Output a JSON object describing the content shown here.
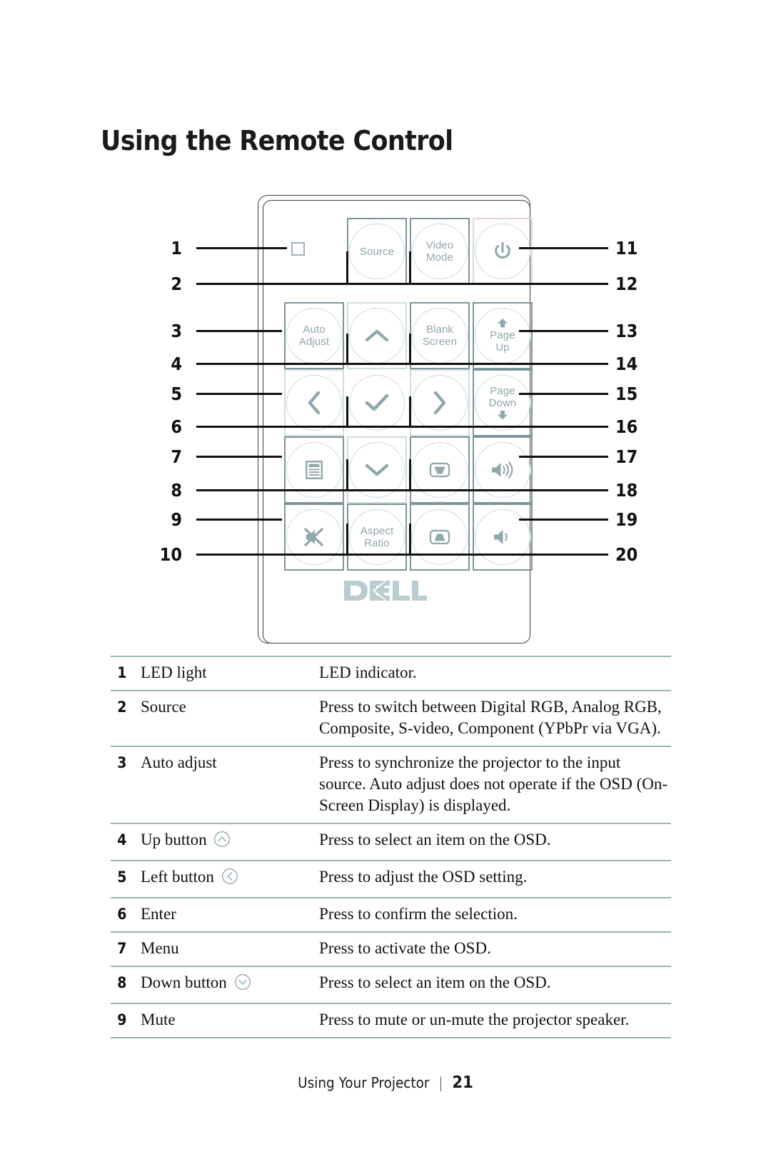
{
  "page": {
    "title": "Using the Remote Control",
    "footer_text": "Using Your Projector",
    "footer_separator": "|",
    "page_number": "21"
  },
  "colors": {
    "frame_teal": "#7d9499",
    "frame_pale": "#cfdcdc",
    "frame_pink": "#e6d5d6",
    "circle_outline": "#c7dbe2",
    "label_text": "#8fa5ab",
    "icon_fill": "#8fa8ad",
    "rule": "#9bb2b5",
    "dell_logo": "#b9cdd0",
    "callout": "#111111"
  },
  "remote": {
    "brand_logo": "DELL",
    "led_indicator_name": "led-light-square",
    "buttons": [
      {
        "id": "source",
        "label": "Source",
        "icon": null,
        "frame": "teal"
      },
      {
        "id": "video-mode",
        "label": "Video\nMode",
        "icon": null,
        "frame": "teal"
      },
      {
        "id": "power",
        "label": "",
        "icon": "power-icon",
        "frame": "pink"
      },
      {
        "id": "auto-adjust",
        "label": "Auto\nAdjust",
        "icon": null,
        "frame": "teal"
      },
      {
        "id": "up",
        "label": "",
        "icon": "chevron-up-icon",
        "frame": "pale"
      },
      {
        "id": "blank-screen",
        "label": "Blank\nScreen",
        "icon": null,
        "frame": "teal"
      },
      {
        "id": "page-up",
        "label": "Page\nUp",
        "icon": "arrow-up-solid-icon",
        "frame": "teal"
      },
      {
        "id": "left",
        "label": "",
        "icon": "chevron-left-icon",
        "frame": "pale"
      },
      {
        "id": "enter",
        "label": "",
        "icon": "check-icon",
        "frame": "none"
      },
      {
        "id": "right",
        "label": "",
        "icon": "chevron-right-icon",
        "frame": "pale"
      },
      {
        "id": "page-down",
        "label": "Page\nDown",
        "icon": "arrow-down-solid-icon",
        "frame": "teal"
      },
      {
        "id": "menu",
        "label": "",
        "icon": "menu-list-icon",
        "frame": "teal"
      },
      {
        "id": "down",
        "label": "",
        "icon": "chevron-down-icon",
        "frame": "pale"
      },
      {
        "id": "keystone-down",
        "label": "",
        "icon": "keystone-down-icon",
        "frame": "teal"
      },
      {
        "id": "volume-up",
        "label": "",
        "icon": "volume-up-icon",
        "frame": "teal"
      },
      {
        "id": "mute",
        "label": "",
        "icon": "mute-icon",
        "frame": "teal"
      },
      {
        "id": "aspect-ratio",
        "label": "Aspect\nRatio",
        "icon": null,
        "frame": "teal"
      },
      {
        "id": "keystone-up",
        "label": "",
        "icon": "keystone-up-icon",
        "frame": "teal"
      },
      {
        "id": "volume-down",
        "label": "",
        "icon": "volume-down-icon",
        "frame": "teal"
      }
    ],
    "button_labels": {
      "source": "Source",
      "video_mode_line1": "Video",
      "video_mode_line2": "Mode",
      "auto_adjust_line1": "Auto",
      "auto_adjust_line2": "Adjust",
      "blank_screen_line1": "Blank",
      "blank_screen_line2": "Screen",
      "page_up_line1": "Page",
      "page_up_line2": "Up",
      "page_down_line1": "Page",
      "page_down_line2": "Down",
      "aspect_ratio_line1": "Aspect",
      "aspect_ratio_line2": "Ratio"
    }
  },
  "callouts": {
    "left": [
      "1",
      "2",
      "3",
      "4",
      "5",
      "6",
      "7",
      "8",
      "9",
      "10"
    ],
    "right": [
      "11",
      "12",
      "13",
      "14",
      "15",
      "16",
      "17",
      "18",
      "19",
      "20"
    ]
  },
  "table": {
    "rows": [
      {
        "num": "1",
        "name": "LED light",
        "name_icon": null,
        "desc": "LED indicator."
      },
      {
        "num": "2",
        "name": "Source",
        "name_icon": null,
        "desc": "Press to switch between Digital RGB, Analog RGB, Composite, S-video, Component (YPbPr via VGA)."
      },
      {
        "num": "3",
        "name": "Auto adjust",
        "name_icon": null,
        "desc": "Press to synchronize the projector to the input source. Auto adjust does not operate if the OSD (On-Screen Display) is displayed."
      },
      {
        "num": "4",
        "name": "Up button",
        "name_icon": "circled-chevron-up-icon",
        "desc": "Press to select an item on the OSD."
      },
      {
        "num": "5",
        "name": "Left button",
        "name_icon": "circled-chevron-left-icon",
        "desc": "Press to adjust the OSD setting."
      },
      {
        "num": "6",
        "name": "Enter",
        "name_icon": null,
        "desc": "Press to confirm the selection."
      },
      {
        "num": "7",
        "name": "Menu",
        "name_icon": null,
        "desc": "Press to activate the OSD."
      },
      {
        "num": "8",
        "name": "Down button",
        "name_icon": "circled-chevron-down-icon",
        "desc": "Press to select an item on the OSD."
      },
      {
        "num": "9",
        "name": "Mute",
        "name_icon": null,
        "desc": "Press to mute or un-mute the projector speaker."
      }
    ]
  }
}
